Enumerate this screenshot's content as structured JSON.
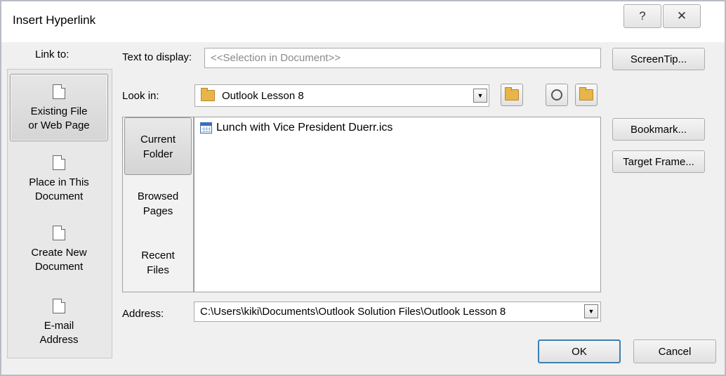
{
  "window": {
    "title": "Insert Hyperlink",
    "help_glyph": "?",
    "close_glyph": "✕"
  },
  "link_to": {
    "label": "Link to:",
    "items": [
      {
        "line1": "Existing File",
        "line2": "or Web Page",
        "icon": "existing-file-icon",
        "selected": true
      },
      {
        "line1": "Place in This",
        "line2": "Document",
        "icon": "place-in-document-icon",
        "selected": false
      },
      {
        "line1": "Create New",
        "line2": "Document",
        "icon": "create-new-document-icon",
        "selected": false
      },
      {
        "line1": "E-mail",
        "line2": "Address",
        "icon": "email-address-icon",
        "selected": false
      }
    ]
  },
  "text_to_display": {
    "label": "Text to display:",
    "value": "<<Selection in Document>>"
  },
  "look_in": {
    "label": "Look in:",
    "value": "Outlook Lesson 8"
  },
  "nav": {
    "items": [
      {
        "line1": "Current",
        "line2": "Folder",
        "selected": true
      },
      {
        "line1": "Browsed",
        "line2": "Pages",
        "selected": false
      },
      {
        "line1": "Recent",
        "line2": "Files",
        "selected": false
      }
    ]
  },
  "files": [
    {
      "name": "Lunch with Vice President Duerr.ics",
      "icon": "calendar-file-icon"
    }
  ],
  "address": {
    "label": "Address:",
    "value": "C:\\Users\\kiki\\Documents\\Outlook Solution Files\\Outlook Lesson 8"
  },
  "buttons": {
    "screentip": "ScreenTip...",
    "bookmark": "Bookmark...",
    "target_frame": "Target Frame...",
    "ok": "OK",
    "cancel": "Cancel"
  },
  "colors": {
    "folder": "#e8b54a",
    "default_button_border": "#3c7fb1"
  }
}
